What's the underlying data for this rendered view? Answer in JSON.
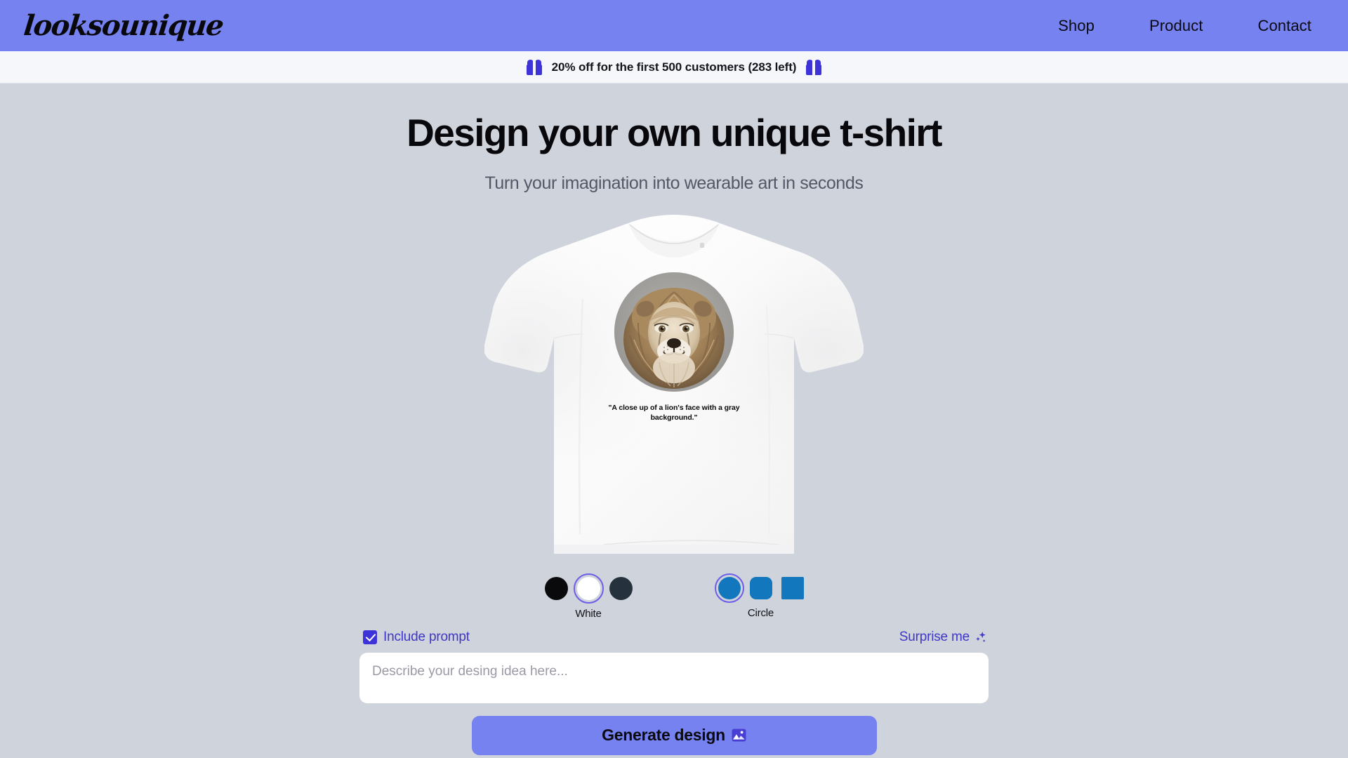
{
  "header": {
    "logo": "looksounique",
    "nav": [
      {
        "label": "Shop"
      },
      {
        "label": "Product"
      },
      {
        "label": "Contact"
      }
    ]
  },
  "promo": {
    "text": "20% off for the first 500 customers (283 left)",
    "left_icon": "gift-icon",
    "right_icon": "gift-icon"
  },
  "hero": {
    "title": "Design your own unique t-shirt",
    "subtitle": "Turn your imagination into wearable art in seconds"
  },
  "mockup": {
    "shirt_color": "#ffffff",
    "shirt_color_name": "White",
    "art_shape": "circle",
    "art_description": "close-up of a lion's face on a gray background",
    "prompt_on_shirt": "\"A close up of a lion's face with a gray background.\""
  },
  "color_picker": {
    "label": "White",
    "selected_index": 1,
    "options": [
      {
        "name": "Black",
        "hex": "#0a0a0c"
      },
      {
        "name": "White",
        "hex": "#ffffff"
      },
      {
        "name": "Navy",
        "hex": "#25323e"
      }
    ],
    "selection_ring": "#6d5de8"
  },
  "shape_picker": {
    "label": "Circle",
    "selected_index": 0,
    "fill": "#1277bd",
    "options": [
      {
        "name": "Circle",
        "shape": "circle"
      },
      {
        "name": "Rounded square",
        "shape": "rounded"
      },
      {
        "name": "Square",
        "shape": "square"
      }
    ],
    "selection_ring": "#6d5de8"
  },
  "prompt_panel": {
    "include_prompt_label": "Include prompt",
    "include_prompt_checked": true,
    "surprise_label": "Surprise me",
    "surprise_icon": "sparkles-icon",
    "textarea_value": "",
    "textarea_placeholder": "Describe your desing idea here...",
    "generate_label": "Generate design",
    "generate_icon": "picture-icon"
  },
  "theme": {
    "header_bg": "#7582f0",
    "banner_bg": "#f6f7fb",
    "page_bg": "#cfd3db",
    "accent": "#3d33d8",
    "link": "#3f37c9",
    "button_bg": "#7582f0"
  }
}
